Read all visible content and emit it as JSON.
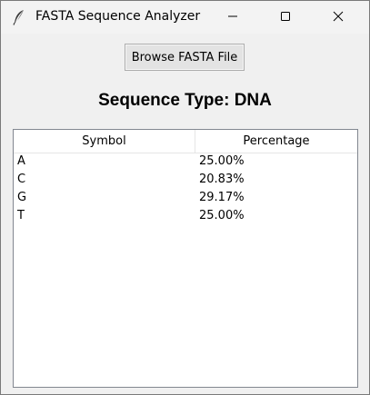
{
  "window": {
    "title": "FASTA Sequence Analyzer",
    "icon": "feather-icon",
    "controls": [
      "minimize-icon",
      "maximize-icon",
      "close-icon"
    ]
  },
  "toolbar": {
    "browse_label": "Browse FASTA File"
  },
  "summary": {
    "sequence_type": "Sequence Type: DNA"
  },
  "table": {
    "columns": [
      "Symbol",
      "Percentage"
    ],
    "rows": [
      {
        "symbol": "A",
        "percentage": "25.00%"
      },
      {
        "symbol": "C",
        "percentage": "20.83%"
      },
      {
        "symbol": "G",
        "percentage": "29.17%"
      },
      {
        "symbol": "T",
        "percentage": "25.00%"
      }
    ]
  }
}
